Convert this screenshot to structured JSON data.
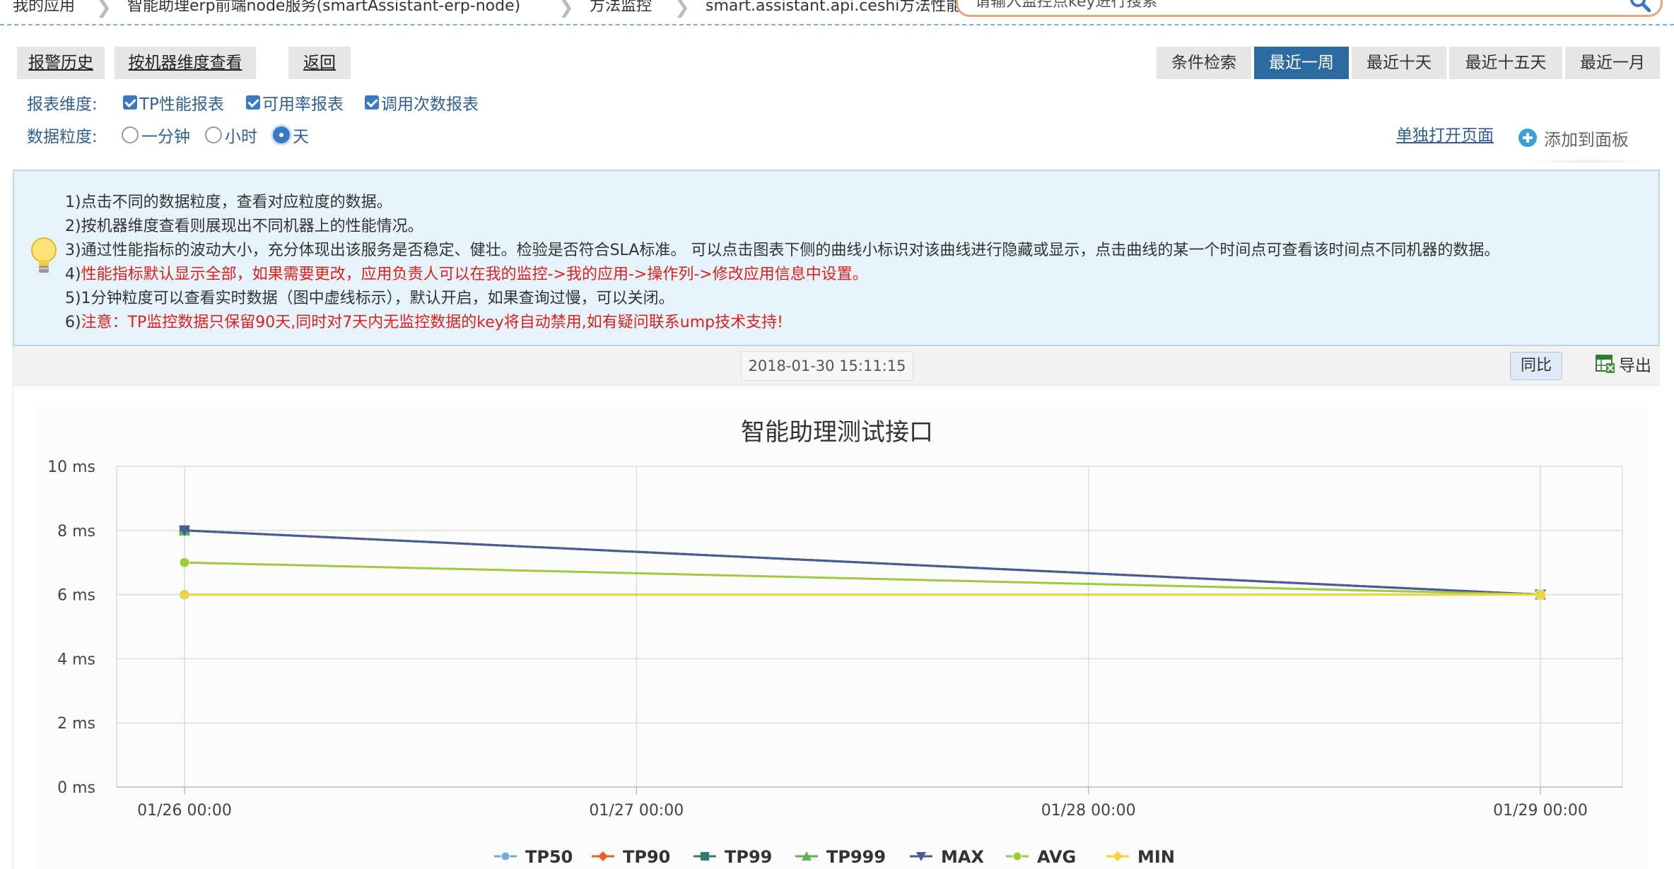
{
  "breadcrumb": [
    {
      "label": "我的应用"
    },
    {
      "label": "智能助理erp前端node服务(smartAssistant-erp-node)"
    },
    {
      "label": "方法监控"
    },
    {
      "label": "smart.assistant.api.ceshi方法性能"
    }
  ],
  "search": {
    "placeholder": "请输入监控点key进行搜索"
  },
  "toolbar": {
    "alarm_history": "报警历史",
    "by_machine": "按机器维度查看",
    "back": "返回",
    "condition_search": "条件检索",
    "ranges": [
      {
        "label": "最近一周",
        "active": true
      },
      {
        "label": "最近十天",
        "active": false
      },
      {
        "label": "最近十五天",
        "active": false
      },
      {
        "label": "最近一月",
        "active": false
      }
    ]
  },
  "report_dimension": {
    "label": "报表维度:",
    "options": [
      {
        "label": "TP性能报表",
        "checked": true
      },
      {
        "label": "可用率报表",
        "checked": true
      },
      {
        "label": "调用次数报表",
        "checked": true
      }
    ]
  },
  "granularity": {
    "label": "数据粒度:",
    "options": [
      {
        "label": "一分钟",
        "selected": false
      },
      {
        "label": "小时",
        "selected": false
      },
      {
        "label": "天",
        "selected": true
      }
    ]
  },
  "links": {
    "open_page": "单独打开页面",
    "add_to_panel": "添加到面板"
  },
  "notice": [
    {
      "text": "1)点击不同的数据粒度，查看对应粒度的数据。",
      "red": false
    },
    {
      "text": "2)按机器维度查看则展现出不同机器上的性能情况。",
      "red": false
    },
    {
      "text": "3)通过性能指标的波动大小，充分体现出该服务是否稳定、健壮。检验是否符合SLA标准。 可以点击图表下侧的曲线小标识对该曲线进行隐藏或显示，点击曲线的某一个时间点可查看该时间点不同机器的数据。",
      "red": false
    },
    {
      "num": "4)",
      "text": "性能指标默认显示全部，如果需要更改，应用负责人可以在我的监控->我的应用->操作列->修改应用信息中设置。",
      "red": true
    },
    {
      "text": "5)1分钟粒度可以查看实时数据（图中虚线标示），默认开启，如果查询过慢，可以关闭。",
      "red": false
    },
    {
      "num": "6)",
      "text": "注意：TP监控数据只保留90天,同时对7天内无监控数据的key将自动禁用,如有疑问联系ump技术支持!",
      "red": true
    }
  ],
  "chart_toolbar": {
    "timestamp": "2018-01-30 15:11:15",
    "yoy": "同比",
    "export": "导出"
  },
  "chart_data": {
    "type": "line",
    "title": "智能助理测试接口",
    "x": [
      "01/26 00:00",
      "01/29 00:00"
    ],
    "x_ticks": [
      "01/26 00:00",
      "01/27 00:00",
      "01/28 00:00",
      "01/29 00:00"
    ],
    "y_ticks": [
      "0 ms",
      "2 ms",
      "4 ms",
      "6 ms",
      "8 ms",
      "10 ms"
    ],
    "ylim": [
      0,
      10
    ],
    "grid": true,
    "legend_position": "bottom",
    "series": [
      {
        "name": "TP50",
        "color": "#6baed6",
        "marker": "circle",
        "values": [
          6,
          6
        ]
      },
      {
        "name": "TP90",
        "color": "#e8602c",
        "marker": "diamond",
        "values": [
          8,
          6
        ]
      },
      {
        "name": "TP99",
        "color": "#2e7d6e",
        "marker": "square",
        "values": [
          8,
          6
        ]
      },
      {
        "name": "TP999",
        "color": "#5cb84c",
        "marker": "triangle",
        "values": [
          8,
          6
        ]
      },
      {
        "name": "MAX",
        "color": "#4a5a9a",
        "marker": "triangle-down",
        "values": [
          8,
          6
        ]
      },
      {
        "name": "AVG",
        "color": "#9ccb3b",
        "marker": "circle",
        "values": [
          7,
          6
        ]
      },
      {
        "name": "MIN",
        "color": "#f5d33a",
        "marker": "diamond",
        "values": [
          6,
          6
        ]
      }
    ]
  }
}
